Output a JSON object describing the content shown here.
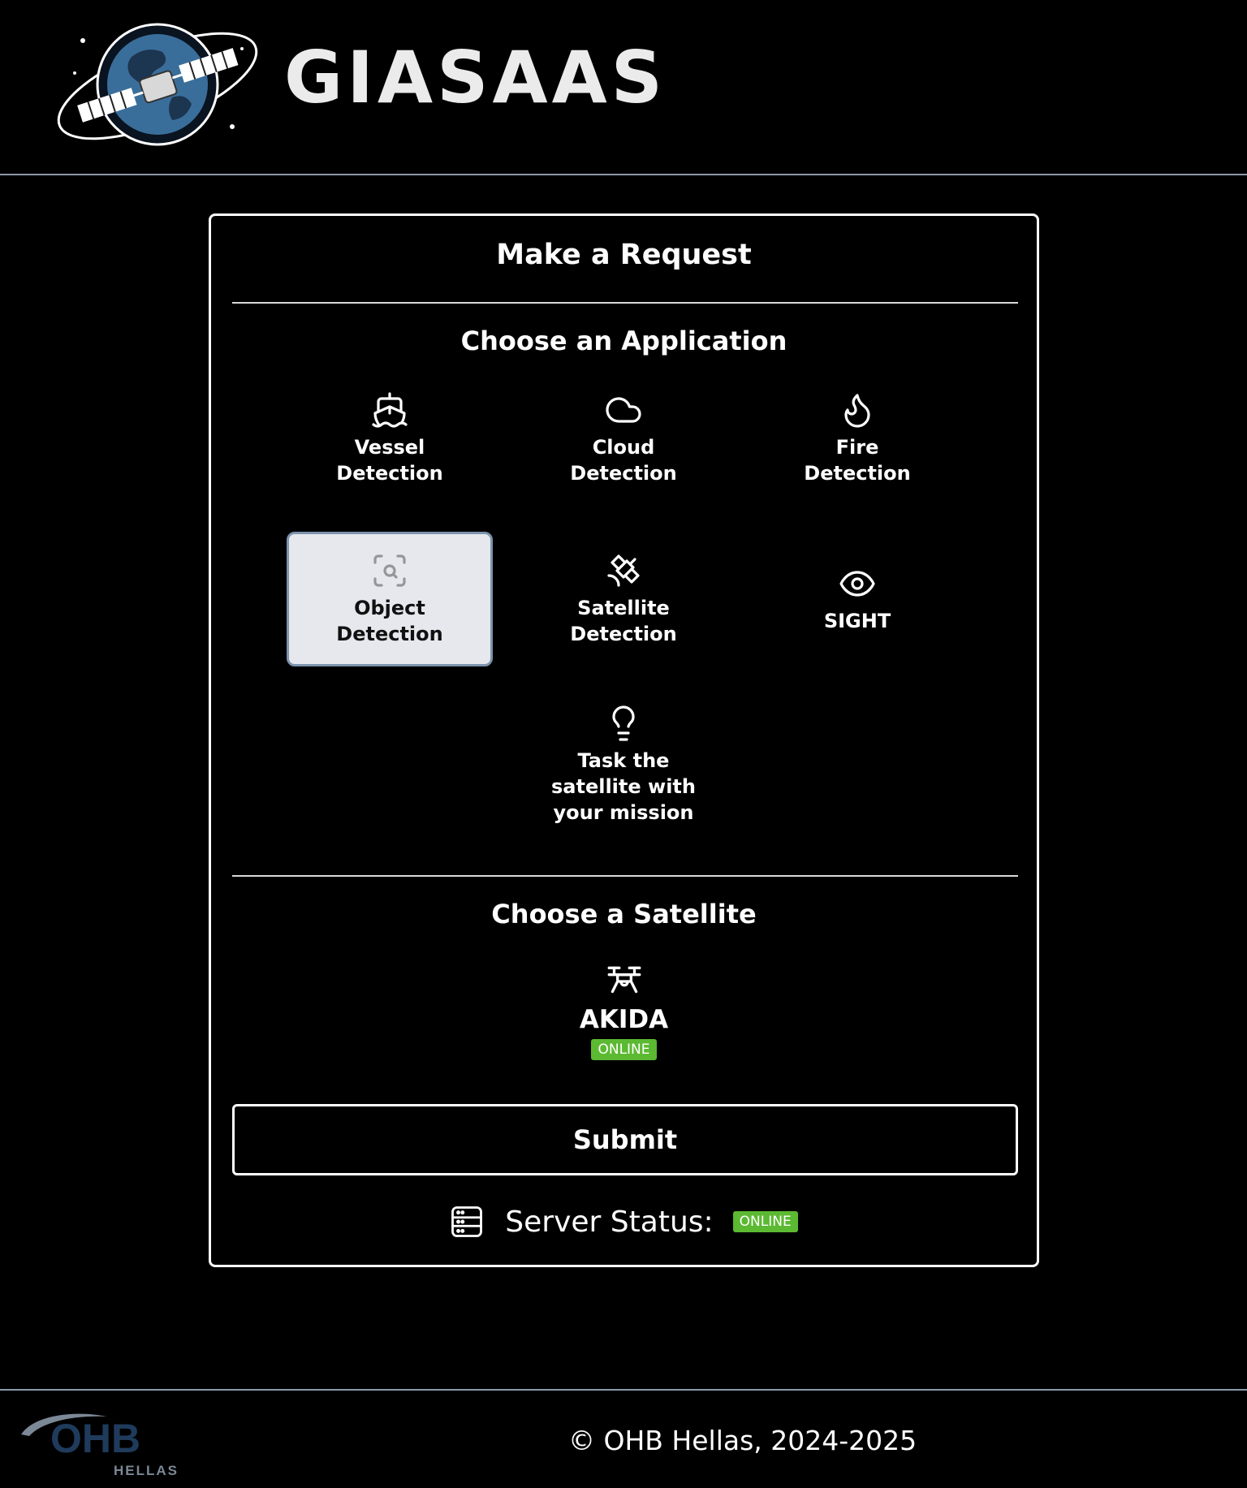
{
  "header": {
    "brand_name": "GIASAAS",
    "logo_icon": "satellite-globe-logo"
  },
  "card": {
    "title": "Make a Request",
    "applications_heading": "Choose an Application",
    "applications": [
      {
        "label": "Vessel\nDetection",
        "icon": "ship-icon",
        "selected": false
      },
      {
        "label": "Cloud\nDetection",
        "icon": "cloud-icon",
        "selected": false
      },
      {
        "label": "Fire\nDetection",
        "icon": "flame-icon",
        "selected": false
      },
      {
        "label": "Object\nDetection",
        "icon": "scan-search-icon",
        "selected": true
      },
      {
        "label": "Satellite\nDetection",
        "icon": "satellite-icon",
        "selected": false
      },
      {
        "label": "SIGHT",
        "icon": "eye-icon",
        "selected": false
      },
      {
        "label": "Task the\nsatellite with\nyour mission",
        "icon": "lightbulb-icon",
        "selected": false
      }
    ],
    "satellite_heading": "Choose a Satellite",
    "satellite": {
      "name": "AKIDA",
      "status": "ONLINE",
      "icon": "drone-icon"
    },
    "submit_label": "Submit",
    "server_status": {
      "label": "Server Status:",
      "status": "ONLINE",
      "icon": "server-icon"
    }
  },
  "footer": {
    "logo_text": "OHB",
    "logo_subtext": "HELLAS",
    "copyright": "© OHB Hellas, 2024-2025"
  },
  "colors": {
    "background": "#000000",
    "online_badge": "#5cb932",
    "selected_tile_bg": "#e6e8ed",
    "selected_tile_border": "#7c93ad",
    "ohb_blue": "#1f3b5c"
  }
}
